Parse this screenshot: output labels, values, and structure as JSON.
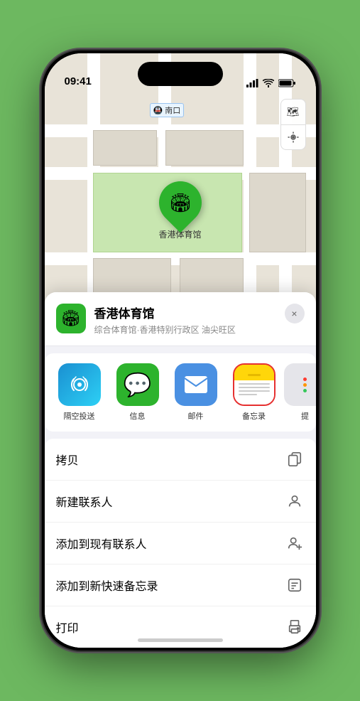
{
  "status": {
    "time": "09:41",
    "location_arrow": true
  },
  "map": {
    "label_text": "南口",
    "pin_label": "香港体育馆"
  },
  "controls": {
    "map_type_icon": "🗺",
    "location_icon": "⌖"
  },
  "place": {
    "name": "香港体育馆",
    "description": "综合体育馆·香港特别行政区 油尖旺区",
    "close_label": "×"
  },
  "share": {
    "items": [
      {
        "id": "airdrop",
        "label": "隔空投送"
      },
      {
        "id": "messages",
        "label": "信息"
      },
      {
        "id": "mail",
        "label": "邮件"
      },
      {
        "id": "notes",
        "label": "备忘录"
      },
      {
        "id": "more",
        "label": "提"
      }
    ]
  },
  "actions": [
    {
      "label": "拷贝",
      "icon": "copy"
    },
    {
      "label": "新建联系人",
      "icon": "person"
    },
    {
      "label": "添加到现有联系人",
      "icon": "person-add"
    },
    {
      "label": "添加到新快速备忘录",
      "icon": "note"
    },
    {
      "label": "打印",
      "icon": "print"
    }
  ]
}
